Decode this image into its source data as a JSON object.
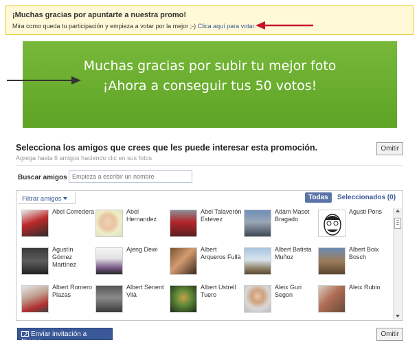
{
  "notice": {
    "title": "¡Muchas gracias por apuntarte a nuestra promo!",
    "text": "Mira como queda tu participación y empieza a votar por la mejor ;-) ",
    "link": "Clica aquí para votar."
  },
  "banner": {
    "line1": "Muchas gracias por subir tu mejor foto",
    "line2": "¡Ahora a conseguir tus 50 votos!"
  },
  "panel": {
    "title": "Selecciona los amigos que crees que les puede interesar esta promoción.",
    "subtitle": "Agrega hasta 6 amigos haciendo clic en sus fotos",
    "omit_label": "Omitir",
    "search_label": "Buscar amigos",
    "search_placeholder": "Empieza a escribir un nombre",
    "filter_label": "Filtrar amigos",
    "tab_all": "Todas",
    "tab_selected": "Seleccionados (0)",
    "send_label": "Enviar invitación a Promo"
  },
  "friends": [
    {
      "name": "Abel Corredera"
    },
    {
      "name": "Abel Hernandez"
    },
    {
      "name": "Abel Talaverón Estevez"
    },
    {
      "name": "Adam Masot Bragado"
    },
    {
      "name": "Agusti Pons"
    },
    {
      "name": "Agustín Gómez Martínez"
    },
    {
      "name": "Ajeng Dewi"
    },
    {
      "name": "Albert Arqueros Fullà"
    },
    {
      "name": "Albert Batista Muñoz"
    },
    {
      "name": "Albert Boix Bosch"
    },
    {
      "name": "Albert Romero Plazas"
    },
    {
      "name": "Albert Senent Vilà"
    },
    {
      "name": "Albert Ustrell Tuero"
    },
    {
      "name": "Aleix Guri Segon"
    },
    {
      "name": "Aleix Rubio"
    }
  ],
  "colors": {
    "notice_bg": "#fff9d7",
    "banner_green": "#6aad2f",
    "fb_blue": "#3b5998",
    "red_arrow": "#c8102e"
  }
}
